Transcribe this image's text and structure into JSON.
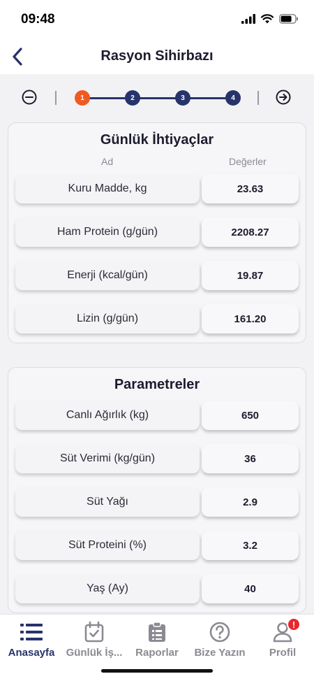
{
  "status_bar": {
    "time": "09:48"
  },
  "nav": {
    "title": "Rasyon Sihirbazı"
  },
  "stepper": {
    "steps": [
      "1",
      "2",
      "3",
      "4"
    ],
    "active_step": 1
  },
  "needs": {
    "title": "Günlük İhtiyaçlar",
    "col_name": "Ad",
    "col_values": "Değerler",
    "rows": [
      {
        "label": "Kuru Madde, kg",
        "value": "23.63"
      },
      {
        "label": "Ham Protein (g/gün)",
        "value": "2208.27"
      },
      {
        "label": "Enerji (kcal/gün)",
        "value": "19.87"
      },
      {
        "label": "Lizin (g/gün)",
        "value": "161.20"
      }
    ]
  },
  "params": {
    "title": "Parametreler",
    "rows": [
      {
        "label": "Canlı Ağırlık (kg)",
        "value": "650"
      },
      {
        "label": "Süt Verimi (kg/gün)",
        "value": "36"
      },
      {
        "label": "Süt Yağı",
        "value": "2.9"
      },
      {
        "label": "Süt Proteini (%)",
        "value": "3.2"
      },
      {
        "label": "Yaş (Ay)",
        "value": "40"
      }
    ]
  },
  "tabs": [
    {
      "label": "Anasayfa",
      "icon": "list-icon",
      "active": true
    },
    {
      "label": "Günlük İş...",
      "icon": "calendar-check-icon",
      "active": false
    },
    {
      "label": "Raporlar",
      "icon": "clipboard-icon",
      "active": false
    },
    {
      "label": "Bize Yazın",
      "icon": "help-circle-icon",
      "active": false
    },
    {
      "label": "Profil",
      "icon": "user-icon",
      "active": false,
      "badge": "!"
    }
  ],
  "colors": {
    "primary": "#27336b",
    "active_step": "#f05a22",
    "badge": "#e8262b"
  }
}
